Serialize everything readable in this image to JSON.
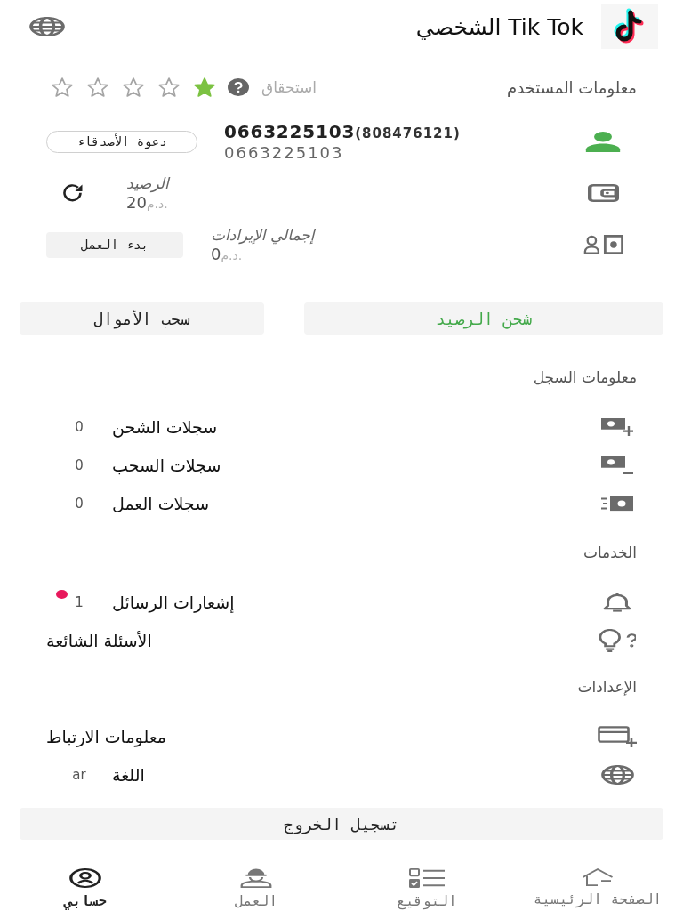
{
  "header": {
    "title": "Tik Tok الشخصي"
  },
  "user_info": {
    "label": "معلومات المستخدم",
    "eligibility": "استحقاق",
    "stars": 1
  },
  "account": {
    "phone": "0663225103",
    "id": "(808476121)",
    "username": "0663225103",
    "invite_button": "دعوة الأصدقاء"
  },
  "balance": {
    "label": "الرصيد",
    "amount": "20",
    "currency": "د.م."
  },
  "earnings": {
    "label": "إجمالي الإيرادات",
    "amount": "0",
    "currency": "د.م.",
    "button": "بدء العمل"
  },
  "actions": [
    {
      "label": "شحن الرصيد",
      "kind": "primary"
    },
    {
      "label": "سحب الأموال",
      "kind": "default"
    }
  ],
  "sections": [
    {
      "title": "معلومات السجل",
      "items": [
        {
          "label": "سجلات الشحن",
          "value": "0",
          "unread": false
        },
        {
          "label": "سجلات السحب",
          "value": "0",
          "unread": false
        },
        {
          "label": "سجلات العمل",
          "value": "0",
          "unread": false
        }
      ]
    },
    {
      "title": "الخدمات",
      "items": [
        {
          "label": "إشعارات الرسائل",
          "value": "1",
          "unread": true
        },
        {
          "label": "الأسئلة الشائعة",
          "unread": false
        }
      ]
    },
    {
      "title": "الإعدادات",
      "items": [
        {
          "label": "معلومات الارتباط",
          "unread": false
        },
        {
          "label": "اللغة",
          "value": "ar",
          "unread": false
        }
      ]
    }
  ],
  "logout_button": "تسجيل الخروج",
  "nav": [
    {
      "label": "الصفحة الرئيسية",
      "selected": false
    },
    {
      "label": "التوقيع",
      "selected": false
    },
    {
      "label": "العمل",
      "selected": false
    },
    {
      "label": "حسابي",
      "selected": true
    }
  ]
}
